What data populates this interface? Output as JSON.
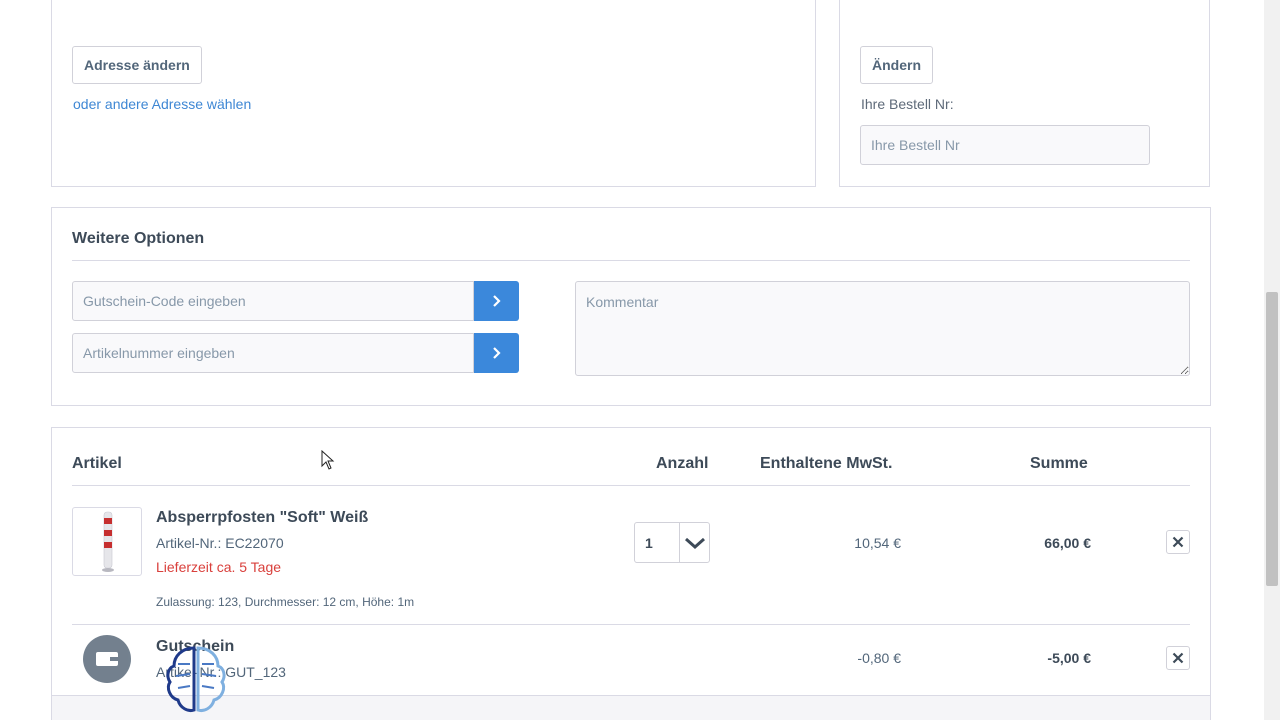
{
  "address": {
    "change_button": "Adresse ändern",
    "other_address_link": "oder andere Adresse wählen"
  },
  "order_ref": {
    "change_button": "Ändern",
    "label": "Ihre Bestell Nr:",
    "placeholder": "Ihre Bestell Nr"
  },
  "options": {
    "title": "Weitere Optionen",
    "voucher_placeholder": "Gutschein-Code eingeben",
    "article_placeholder": "Artikelnummer eingeben",
    "comment_placeholder": "Kommentar"
  },
  "cart": {
    "headers": {
      "article": "Artikel",
      "quantity": "Anzahl",
      "vat": "Enthaltene MwSt.",
      "total": "Summe"
    },
    "items": [
      {
        "name": "Absperrpfosten \"Soft\" Weiß",
        "sku": "Artikel-Nr.: EC22070",
        "delivery": "Lieferzeit ca. 5 Tage",
        "attributes": "Zulassung: 123, Durchmesser: 12 cm, Höhe: 1m",
        "quantity": "1",
        "vat": "10,54 €",
        "total": "66,00 €"
      },
      {
        "name": "Gutschein",
        "sku": "Artikel-Nr.: GUT_123",
        "vat": "-0,80 €",
        "total": "-5,00 €"
      }
    ]
  },
  "colors": {
    "accent": "#3b88db",
    "delivery_warning": "#d9403c"
  }
}
